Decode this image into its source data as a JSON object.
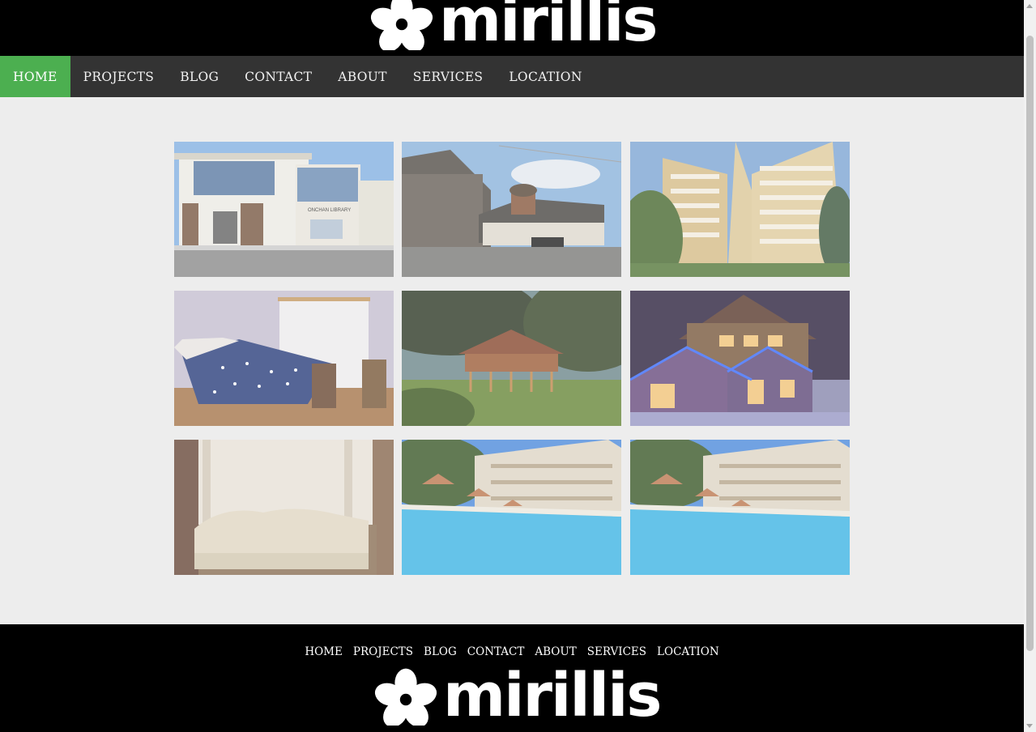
{
  "brand": {
    "logo_text": "mirillis"
  },
  "nav": {
    "items": [
      {
        "label": "HOME",
        "active": true
      },
      {
        "label": "PROJECTS"
      },
      {
        "label": "BLOG"
      },
      {
        "label": "CONTACT"
      },
      {
        "label": "ABOUT"
      },
      {
        "label": "SERVICES"
      },
      {
        "label": "LOCATION"
      }
    ]
  },
  "gallery": {
    "images": [
      {
        "subject": "library-building",
        "sign": "ONCHAN LIBRARY"
      },
      {
        "subject": "church-and-hall"
      },
      {
        "subject": "high-rise-hotel"
      },
      {
        "subject": "bedroom-star-blanket"
      },
      {
        "subject": "wooden-house-garden"
      },
      {
        "subject": "chalet-night-lights"
      },
      {
        "subject": "room-with-sofa"
      },
      {
        "subject": "hotel-pool"
      },
      {
        "subject": "hotel-pool"
      }
    ]
  },
  "footer": {
    "nav": [
      "HOME",
      "PROJECTS",
      "BLOG",
      "CONTACT",
      "ABOUT",
      "SERVICES",
      "LOCATION"
    ],
    "logo_text": "mirillis"
  },
  "colors": {
    "accent": "#4caf50",
    "nav_bg": "#333333",
    "header_bg": "#000000",
    "page_bg": "#ededed"
  }
}
